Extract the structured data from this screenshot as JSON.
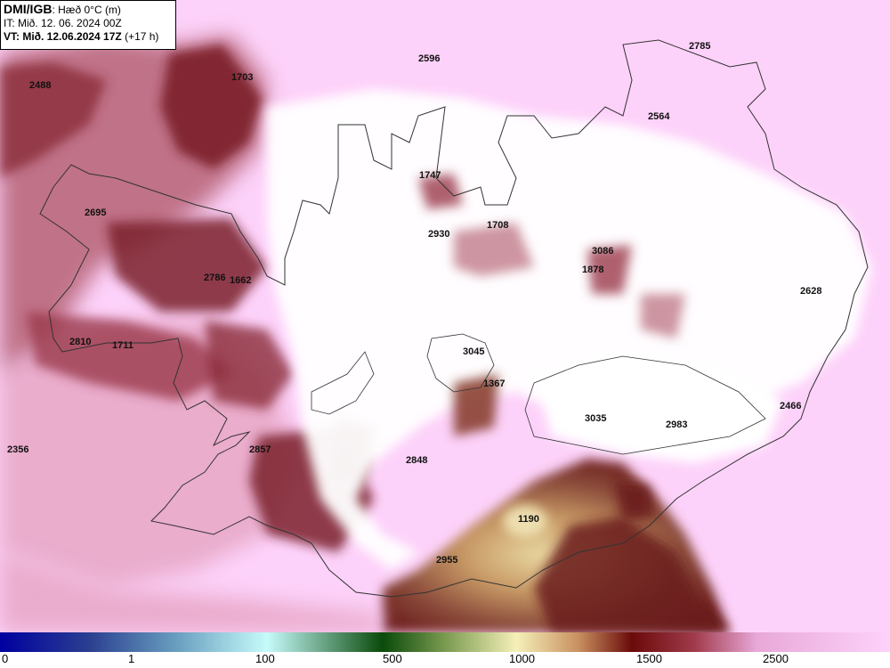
{
  "header": {
    "brand": "DMI/IGB",
    "title_suffix": ": Hæð 0°C (m)",
    "it_line": "IT: Mið. 12. 06. 2024 00Z",
    "vt_main": "VT: Mið. 12.06.2024 17Z",
    "vt_offset": " (+17 h)"
  },
  "labels": [
    {
      "text": "2488"
    },
    {
      "text": "1703"
    },
    {
      "text": "2596"
    },
    {
      "text": "2785"
    },
    {
      "text": "2564"
    },
    {
      "text": "1747"
    },
    {
      "text": "2695"
    },
    {
      "text": "1708"
    },
    {
      "text": "2930"
    },
    {
      "text": "3086"
    },
    {
      "text": "1878"
    },
    {
      "text": "2786"
    },
    {
      "text": "1662"
    },
    {
      "text": "2628"
    },
    {
      "text": "2810"
    },
    {
      "text": "1711"
    },
    {
      "text": "3045"
    },
    {
      "text": "1367"
    },
    {
      "text": "3035"
    },
    {
      "text": "2983"
    },
    {
      "text": "2466"
    },
    {
      "text": "2356"
    },
    {
      "text": "2857"
    },
    {
      "text": "2848"
    },
    {
      "text": "1190"
    },
    {
      "text": "2955"
    }
  ],
  "colorbar": {
    "ticks": [
      "0",
      "1",
      "100",
      "500",
      "1000",
      "1500",
      "2500"
    ],
    "colors": [
      "#0000a0",
      "#2a3f90",
      "#6aa0c0",
      "#c6fbfb",
      "#0a4a0a",
      "#7a9a50",
      "#f5f0b8",
      "#c89060",
      "#6a0a0a",
      "#a03a4a",
      "#e8a8d8",
      "#fdd2fa"
    ]
  },
  "map_colors": {
    "background": "#fdd2fa",
    "dark_red": "#7a1f1f",
    "brown": "#96603a",
    "tan": "#c8a270",
    "white": "#ffffff",
    "coast": "#333333"
  }
}
